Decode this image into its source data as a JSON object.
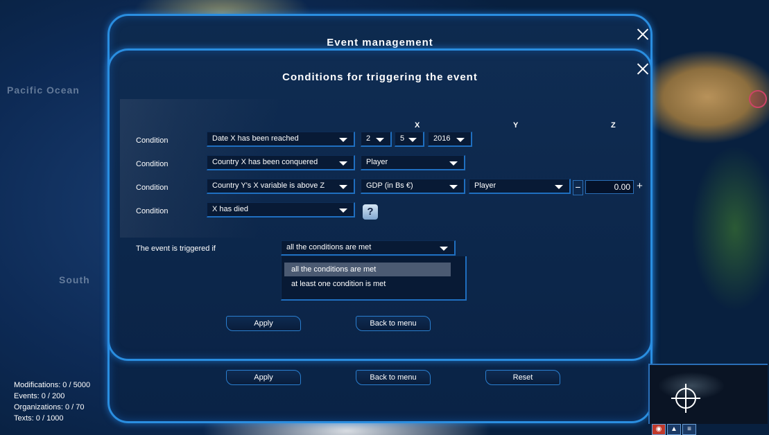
{
  "map": {
    "labels": {
      "pacific": "Pacific Ocean",
      "south": "South"
    }
  },
  "outer_panel": {
    "title": "Event management",
    "buttons": {
      "apply": "Apply",
      "back": "Back to menu",
      "reset": "Reset"
    }
  },
  "inner_panel": {
    "title": "Conditions for triggering the event",
    "column_headers": {
      "x": "X",
      "y": "Y",
      "z": "Z"
    },
    "conditions": [
      {
        "label": "Condition",
        "type": "Date X has been reached",
        "x_day": "2",
        "x_month": "5",
        "x_year": "2016"
      },
      {
        "label": "Condition",
        "type": "Country X has been conquered",
        "x": "Player"
      },
      {
        "label": "Condition",
        "type": "Country Y's X variable is above Z",
        "x": "GDP (in Bs €)",
        "y": "Player",
        "z": "0.00",
        "minus": "−",
        "plus": "+"
      },
      {
        "label": "Condition",
        "type": "X has died",
        "x_icon": "help-icon",
        "x_icon_glyph": "?"
      }
    ],
    "trigger": {
      "label": "The event is triggered if",
      "selected": "all the conditions are met",
      "options": [
        "all the conditions are met",
        "at least one condition is met"
      ]
    },
    "buttons": {
      "apply": "Apply",
      "back": "Back to menu"
    }
  },
  "status": {
    "modifications": "Modifications: 0 /  5000",
    "events": "Events: 0 /  200",
    "organizations": "Organizations: 0 /  70",
    "texts": "Texts: 0 /  1000"
  },
  "colors": {
    "accent": "#2a8ee0",
    "panel": "#0b2447",
    "highlight": "#4b5a72"
  }
}
